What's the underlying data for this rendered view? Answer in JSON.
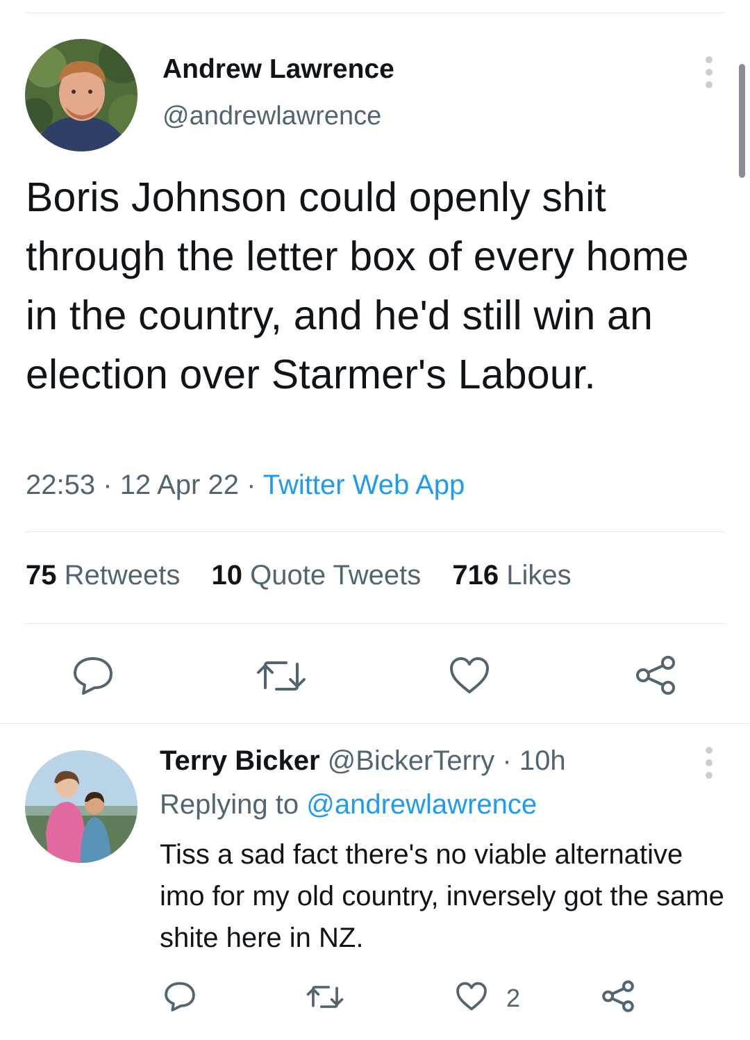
{
  "tweet": {
    "author_name": "Andrew Lawrence",
    "author_handle": "@andrewlawrence",
    "text": "Boris Johnson could openly shit through the letter box of every home in the country, and he'd still win an election over Starmer's Labour.",
    "time": "22:53",
    "date": "12 Apr 22",
    "separator": "·",
    "source": "Twitter Web App",
    "stats": {
      "retweets_count": "75",
      "retweets_label": "Retweets",
      "quotes_count": "10",
      "quotes_label": "Quote Tweets",
      "likes_count": "716",
      "likes_label": "Likes"
    },
    "actions": [
      "reply-icon",
      "retweet-icon",
      "like-icon",
      "share-icon"
    ]
  },
  "reply": {
    "author_name": "Terry Bicker",
    "author_handle": "@BickerTerry",
    "separator": "·",
    "time": "10h",
    "replying_prefix": "Replying to",
    "replying_to": "@andrewlawrence",
    "text": "Tiss a sad fact there's no viable alternative imo for my old country, inversely got the same shite here in NZ.",
    "like_count": "2",
    "actions": [
      "reply-icon",
      "retweet-icon",
      "like-icon",
      "share-icon"
    ]
  },
  "colors": {
    "text": "#0f1419",
    "secondary": "#536471",
    "link": "#1d9bf0",
    "divider": "#e6e9ec"
  }
}
